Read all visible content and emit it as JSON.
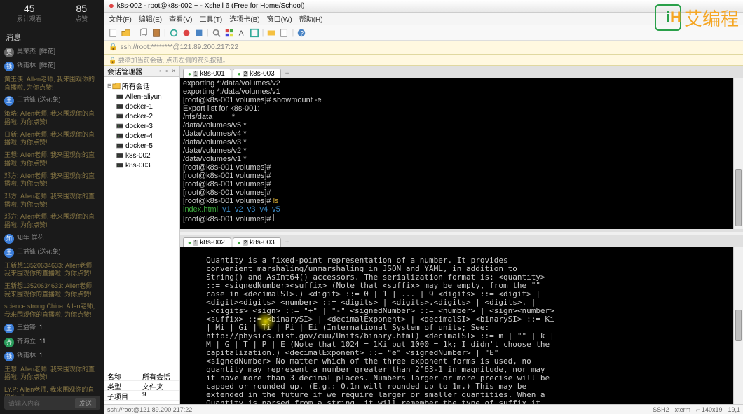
{
  "left": {
    "stats": [
      {
        "num": "45",
        "lbl": "累计观看"
      },
      {
        "num": "85",
        "lbl": "点赞"
      }
    ],
    "msg_header": "消息",
    "chat": [
      {
        "av": "gray",
        "name": "吴荣杰:",
        "text": "",
        "suf": " [鲜花]"
      },
      {
        "av": "blue",
        "name": "钱雨林:",
        "text": "",
        "suf": " [鲜花]"
      },
      {
        "av": "",
        "name": "",
        "text": "黄玉侠: Allen老师, 我来围观你的直播啦, 为你点赞!",
        "suf": ""
      },
      {
        "av": "blue",
        "name": "王益锋",
        "text": "",
        "suf": " (送花兔)"
      },
      {
        "av": "",
        "name": "",
        "text": "策略: Allen老师, 我来围观你的直播啦, 为你点赞!",
        "suf": ""
      },
      {
        "av": "",
        "name": "",
        "text": "日新: Allen老师, 我来围观你的直播啦, 为你点赞!",
        "suf": ""
      },
      {
        "av": "",
        "name": "",
        "text": "王想: Allen老师, 我来围观你的直播啦, 为你点赞!",
        "suf": ""
      },
      {
        "av": "",
        "name": "",
        "text": "邓方: Allen老师, 我来围观你的直播啦, 为你点赞!",
        "suf": ""
      },
      {
        "av": "",
        "name": "",
        "text": "邓方: Allen老师, 我来围观你的直播啦, 为你点赞!",
        "suf": ""
      },
      {
        "av": "",
        "name": "",
        "text": "邓方: Allen老师, 我来围观你的直播啦, 为你点赞!",
        "suf": ""
      },
      {
        "av": "blue",
        "name": "知年",
        "text": "",
        "suf": " 鲜花"
      },
      {
        "av": "blue",
        "name": "王益锋",
        "text": "",
        "suf": " (送花兔)"
      },
      {
        "av": "",
        "name": "",
        "text": "王新想13520634633: Allen老师, 我来围观你的直播啦, 为你点赞!",
        "suf": ""
      },
      {
        "av": "",
        "name": "",
        "text": "王新想13520634633: Allen老师, 我来围观你的直播啦, 为你点赞!",
        "suf": ""
      },
      {
        "av": "",
        "name": "",
        "text": "science strong China: Allen老师, 我来围观你的直播啦, 为你点赞!",
        "suf": ""
      },
      {
        "av": "blue",
        "name": "王益锋:",
        "text": " 1",
        "suf": ""
      },
      {
        "av": "green",
        "name": "齐海立:",
        "text": " 11",
        "suf": ""
      },
      {
        "av": "blue",
        "name": "钱雨林:",
        "text": " 1",
        "suf": ""
      },
      {
        "av": "",
        "name": "",
        "text": "王想: Allen老师, 我来围观你的直播啦, 为你点赞!",
        "suf": ""
      },
      {
        "av": "",
        "name": "",
        "text": "LY.P: Allen老师, 我来围观你的直播啦, 为",
        "suf": ""
      }
    ],
    "send_placeholder": "请输入内容",
    "send_btn": "发送"
  },
  "app": {
    "title": "k8s-002 - root@k8s-002:~ - Xshell 6 (Free for Home/School)",
    "menus": [
      "文件(F)",
      "编辑(E)",
      "查看(V)",
      "工具(T)",
      "选项卡(B)",
      "窗口(W)",
      "帮助(H)"
    ],
    "address": "ssh://root:********@121.89.200.217:22",
    "tip": "🔒 要添加当前会话, 点击左侧的箭头按钮。"
  },
  "session": {
    "header": "会话管理器",
    "root": "所有会话",
    "nodes": [
      "Allen-aliyun",
      "docker-1",
      "docker-2",
      "docker-3",
      "docker-4",
      "docker-5",
      "k8s-002",
      "k8s-003"
    ],
    "props": [
      {
        "k": "名称",
        "v": "所有会话"
      },
      {
        "k": "类型",
        "v": "文件夹"
      },
      {
        "k": "子项目",
        "v": "9"
      }
    ]
  },
  "term1": {
    "tabs": [
      {
        "num": "1",
        "label": "k8s-001"
      },
      {
        "num": "2",
        "label": "k8s-003"
      }
    ],
    "lines": [
      [
        {
          "c": "w",
          "t": "exporting *:/data/volumes/v2"
        }
      ],
      [
        {
          "c": "w",
          "t": "exporting *:/data/volumes/v1"
        }
      ],
      [
        {
          "c": "w",
          "t": "[root@k8s-001 volumes]# showmount -e"
        }
      ],
      [
        {
          "c": "w",
          "t": "Export list for k8s-001:"
        }
      ],
      [
        {
          "c": "w",
          "t": "/nfs/data         *"
        }
      ],
      [
        {
          "c": "w",
          "t": "/data/volumes/v5 *"
        }
      ],
      [
        {
          "c": "w",
          "t": "/data/volumes/v4 *"
        }
      ],
      [
        {
          "c": "w",
          "t": "/data/volumes/v3 *"
        }
      ],
      [
        {
          "c": "w",
          "t": "/data/volumes/v2 *"
        }
      ],
      [
        {
          "c": "w",
          "t": "/data/volumes/v1 *"
        }
      ],
      [
        {
          "c": "w",
          "t": "[root@k8s-001 volumes]# "
        }
      ],
      [
        {
          "c": "w",
          "t": "[root@k8s-001 volumes]# "
        }
      ],
      [
        {
          "c": "w",
          "t": "[root@k8s-001 volumes]# "
        }
      ],
      [
        {
          "c": "w",
          "t": "[root@k8s-001 volumes]# "
        }
      ],
      [
        {
          "c": "w",
          "t": "[root@k8s-001 volumes]# "
        },
        {
          "c": "y",
          "t": "ls"
        }
      ],
      [
        {
          "c": "g",
          "t": "index.html"
        },
        {
          "c": "w",
          "t": "  "
        },
        {
          "c": "c",
          "t": "v1  v2  v3  v4  v5"
        }
      ],
      [
        {
          "c": "w",
          "t": "[root@k8s-001 volumes]# "
        }
      ]
    ]
  },
  "term2": {
    "tabs": [
      {
        "num": "1",
        "label": "k8s-002"
      },
      {
        "num": "2",
        "label": "k8s-003"
      }
    ],
    "body": "     Quantity is a fixed-point representation of a number. It provides\n     convenient marshaling/unmarshaling in JSON and YAML, in addition to\n     String() and AsInt64() accessors. The serialization format is: <quantity>\n     ::= <signedNumber><suffix> (Note that <suffix> may be empty, from the \"\"\n     case in <decimalSI>.) <digit> ::= 0 | 1 | ... | 9 <digits> ::= <digit> |\n     <digit><digits> <number> ::= <digits> | <digits>.<digits> | <digits>. |\n     .<digits> <sign> ::= \"+\" | \"-\" <signedNumber> ::= <number> | <sign><number>\n     <suffix> ::= <binarySI> | <decimalExponent> | <decimalSI> <binarySI> ::= Ki\n     | Mi | Gi | Ti | Pi | Ei (International System of units; See:\n     http://physics.nist.gov/cuu/Units/binary.html) <decimalSI> ::= m | \"\" | k |\n     M | G | T | P | E (Note that 1024 = 1Ki but 1000 = 1k; I didn't choose the\n     capitalization.) <decimalExponent> ::= \"e\" <signedNumber> | \"E\"\n     <signedNumber> No matter which of the three exponent forms is used, no\n     quantity may represent a number greater than 2^63-1 in magnitude, nor may\n     it have more than 3 decimal places. Numbers larger or more precise will be\n     capped or rounded up. (E.g.: 0.1m will rounded up to 1m.) This may be\n     extended in the future if we require larger or smaller quantities. When a\n     Quantity is parsed from a string, it will remember the type of suffix it"
  },
  "status": {
    "left": "ssh://root@121.89.200.217:22",
    "right": [
      "SSH2",
      "xterm",
      "⌐ 140x19",
      "19,1"
    ]
  },
  "watermark": "艾编程"
}
